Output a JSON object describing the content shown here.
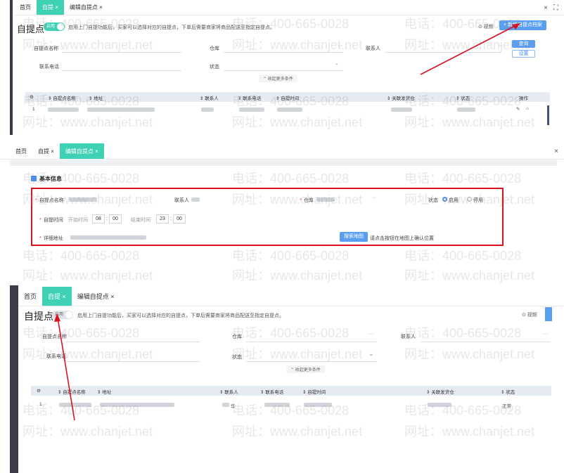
{
  "panel1": {
    "tabs": [
      {
        "label": "首页"
      },
      {
        "label": "自提 ×"
      },
      {
        "label": "编辑自提点 ×"
      }
    ],
    "window_tools": [
      "×",
      "⛶"
    ],
    "title": "自提点",
    "toggle_label": "启用",
    "description": "启用上门自提功能后，买家可以选择对应的自提点，下单后需要商家将商品配送至指定自提点。",
    "video_label": "⊙ 视频",
    "add_button": "+ 新增自提点档案",
    "filters": {
      "name": "自提点名称",
      "warehouse": "仓库",
      "contact": "联系人",
      "phone": "联系电话",
      "status": "状态"
    },
    "query_button": "查询",
    "reset_button": "设置",
    "collapse_label": "⌃ 收起更多条件",
    "headers": [
      "⇕ 自提点名称",
      "⇕ 地址",
      "⇕ 联系人",
      "⇕ 联系电话",
      "⇕ 自提时间",
      "⇕ 关联发货仓",
      "⇕ 状态",
      "操作"
    ],
    "row_index": "1",
    "row_ops": [
      "✎",
      "⌂"
    ]
  },
  "panel2": {
    "tabs": [
      {
        "label": "首页"
      },
      {
        "label": "自提 ×"
      },
      {
        "label": "编辑自提点 ×"
      }
    ],
    "close": "×",
    "section_title": "基本信息",
    "name_label": "自提点名称",
    "contact_label": "联系人",
    "warehouse_label": "仓库",
    "status_label": "状态",
    "status_on": "启用",
    "status_off": "停用",
    "time_label": "自提时间",
    "start_label": "开始时间",
    "start_hour": "08",
    "start_min": "00",
    "end_label": "结束时间",
    "end_hour": "23",
    "end_min": "00",
    "address_label": "详细地址",
    "search_map_button": "搜索地图",
    "map_hint": "请点击按钮在地图上确认位置"
  },
  "panel3": {
    "tabs": [
      {
        "label": "首页"
      },
      {
        "label": "自提 ×"
      },
      {
        "label": "编辑自提点 ×"
      }
    ],
    "title": "自提点",
    "toggle_label": "启用",
    "description": "启用上门自提功能后，买家可以选择对应的自提点，下单后需要商家将商品配送至指定自提点。",
    "video_label": "⊙ 视频",
    "filters": {
      "name": "自提点名称",
      "warehouse": "仓库",
      "contact": "联系人",
      "phone": "联系电话",
      "status": "状态"
    },
    "collapse_label": "⌃ 收起更多条件",
    "headers": [
      "⇕ 自提点名称",
      "⇕ 地址",
      "⇕ 联系人",
      "⇕ 联系电话",
      "⇕ 自提时间",
      "⇕ 关联发货仓",
      "⇕ 状态"
    ],
    "row_index": "1",
    "row_contact_suffix": "华",
    "row_status": "正常"
  },
  "watermark": {
    "phone": "电话：400-665-0028",
    "site": "网址：www.chanjet.net"
  },
  "colors": {
    "accent": "#3fd1b4",
    "primary": "#5a9ef3",
    "annotation": "#d8131e"
  }
}
